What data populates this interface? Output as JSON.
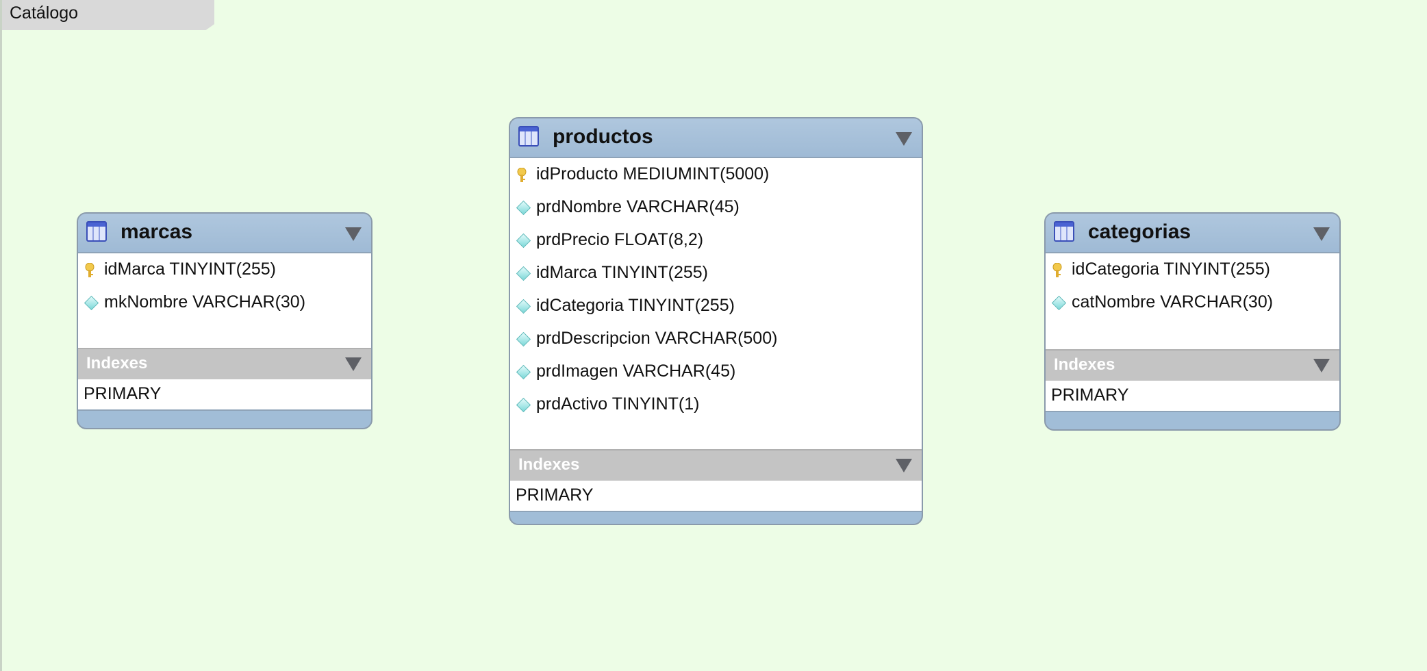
{
  "layer": {
    "title": "Catálogo"
  },
  "tables": {
    "marcas": {
      "name": "marcas",
      "columns": [
        {
          "text": "idMarca TINYINT(255)",
          "icon": "primary-key-icon"
        },
        {
          "text": "mkNombre VARCHAR(30)",
          "icon": "column-diamond-icon"
        }
      ],
      "indexes_label": "Indexes",
      "indexes": [
        "PRIMARY"
      ]
    },
    "productos": {
      "name": "productos",
      "columns": [
        {
          "text": "idProducto MEDIUMINT(5000)",
          "icon": "primary-key-icon"
        },
        {
          "text": "prdNombre VARCHAR(45)",
          "icon": "column-diamond-icon"
        },
        {
          "text": "prdPrecio FLOAT(8,2)",
          "icon": "column-diamond-icon"
        },
        {
          "text": "idMarca TINYINT(255)",
          "icon": "column-diamond-icon"
        },
        {
          "text": "idCategoria TINYINT(255)",
          "icon": "column-diamond-icon"
        },
        {
          "text": "prdDescripcion VARCHAR(500)",
          "icon": "column-diamond-icon"
        },
        {
          "text": "prdImagen VARCHAR(45)",
          "icon": "column-diamond-icon"
        },
        {
          "text": "prdActivo TINYINT(1)",
          "icon": "column-diamond-icon"
        }
      ],
      "indexes_label": "Indexes",
      "indexes": [
        "PRIMARY"
      ]
    },
    "categorias": {
      "name": "categorias",
      "columns": [
        {
          "text": "idCategoria TINYINT(255)",
          "icon": "primary-key-icon"
        },
        {
          "text": "catNombre VARCHAR(30)",
          "icon": "column-diamond-icon"
        }
      ],
      "indexes_label": "Indexes",
      "indexes": [
        "PRIMARY"
      ]
    }
  },
  "colors": {
    "canvas": "#edfde6",
    "table_header": "#a1bdd7",
    "index_header": "#c4c4c4",
    "key": "#e9b93a",
    "column_diamond": "#7dd8d8"
  }
}
